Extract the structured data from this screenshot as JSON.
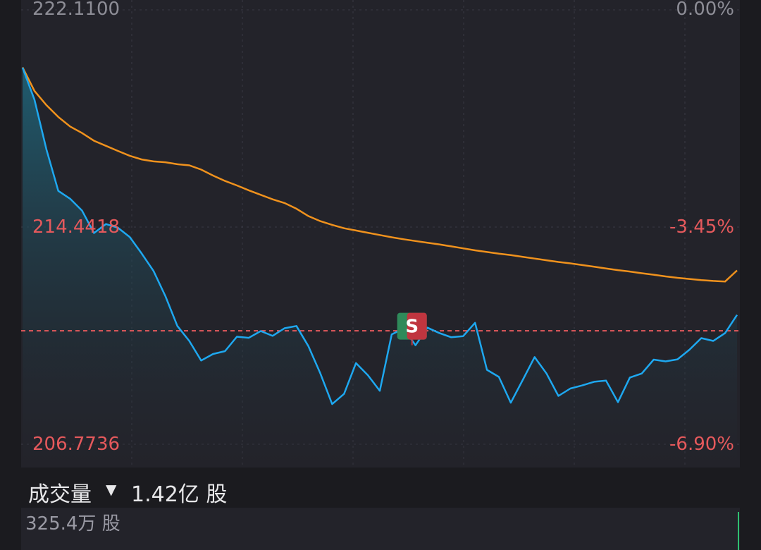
{
  "chart_data": {
    "type": "line",
    "title": "",
    "xlabel": "",
    "ylabel": "",
    "ylim": [
      206.7736,
      222.11
    ],
    "reference_price": 222.11,
    "price_axis_labels": [
      "222.1100",
      "214.4418",
      "206.7736"
    ],
    "percent_axis_labels": [
      "0.00%",
      "-3.45%",
      "-6.90%"
    ],
    "x": [
      0,
      4,
      8,
      12,
      16,
      20,
      24,
      28,
      32,
      36,
      40,
      44,
      48,
      52,
      56,
      60,
      64,
      68,
      72,
      76,
      80,
      84,
      88,
      92,
      96,
      100,
      104,
      108,
      112,
      116,
      120,
      124,
      128,
      132,
      136,
      140,
      144,
      148,
      152,
      156,
      160,
      164,
      168,
      172,
      176,
      180,
      184,
      188,
      192,
      196,
      200,
      204,
      208,
      212,
      216,
      220,
      224,
      228,
      232,
      236,
      240
    ],
    "series": [
      {
        "values": [
          220.07,
          218.94,
          217.19,
          215.72,
          215.44,
          215.02,
          214.23,
          214.55,
          214.42,
          214.09,
          213.51,
          212.89,
          212.0,
          210.95,
          210.42,
          209.73,
          209.96,
          210.06,
          210.57,
          210.53,
          210.77,
          210.6,
          210.87,
          210.95,
          210.24,
          209.28,
          208.19,
          208.55,
          209.64,
          209.21,
          208.66,
          210.65,
          210.86,
          210.27,
          210.89,
          210.7,
          210.55,
          210.59,
          211.06,
          209.4,
          209.15,
          208.24,
          209.04,
          209.85,
          209.27,
          208.48,
          208.74,
          208.85,
          208.98,
          209.02,
          208.26,
          209.13,
          209.27,
          209.76,
          209.7,
          209.77,
          210.11,
          210.52,
          210.42,
          210.7,
          211.34
        ],
        "color": "#1ea8f0"
      },
      {
        "values": [
          220.08,
          219.25,
          218.75,
          218.33,
          217.99,
          217.76,
          217.49,
          217.31,
          217.13,
          216.96,
          216.83,
          216.76,
          216.73,
          216.66,
          216.62,
          216.47,
          216.26,
          216.07,
          215.91,
          215.74,
          215.58,
          215.42,
          215.29,
          215.09,
          214.83,
          214.65,
          214.52,
          214.4,
          214.32,
          214.24,
          214.16,
          214.08,
          214.01,
          213.95,
          213.89,
          213.83,
          213.76,
          213.69,
          213.62,
          213.56,
          213.5,
          213.45,
          213.39,
          213.33,
          213.27,
          213.21,
          213.16,
          213.1,
          213.04,
          212.98,
          212.92,
          212.87,
          212.81,
          212.76,
          212.7,
          212.65,
          212.61,
          212.57,
          212.54,
          212.52,
          212.91
        ],
        "color": "#f0921d"
      }
    ],
    "prev_close_line": 210.78,
    "marker": {
      "x": 132,
      "label": "S"
    },
    "colors": {
      "price_line": "#1ea8f0",
      "avg_line": "#f0921d",
      "up_red": "#e5595c",
      "neutral_axis": "#8d8d96",
      "grid": "#3a3a44",
      "marker_red": "#c0353f",
      "marker_green": "#2f8a5a"
    }
  },
  "volume": {
    "title": "成交量",
    "dropdown_icon": "caret-down-icon",
    "total": "1.42亿 股",
    "scale_label": "325.4万 股"
  }
}
